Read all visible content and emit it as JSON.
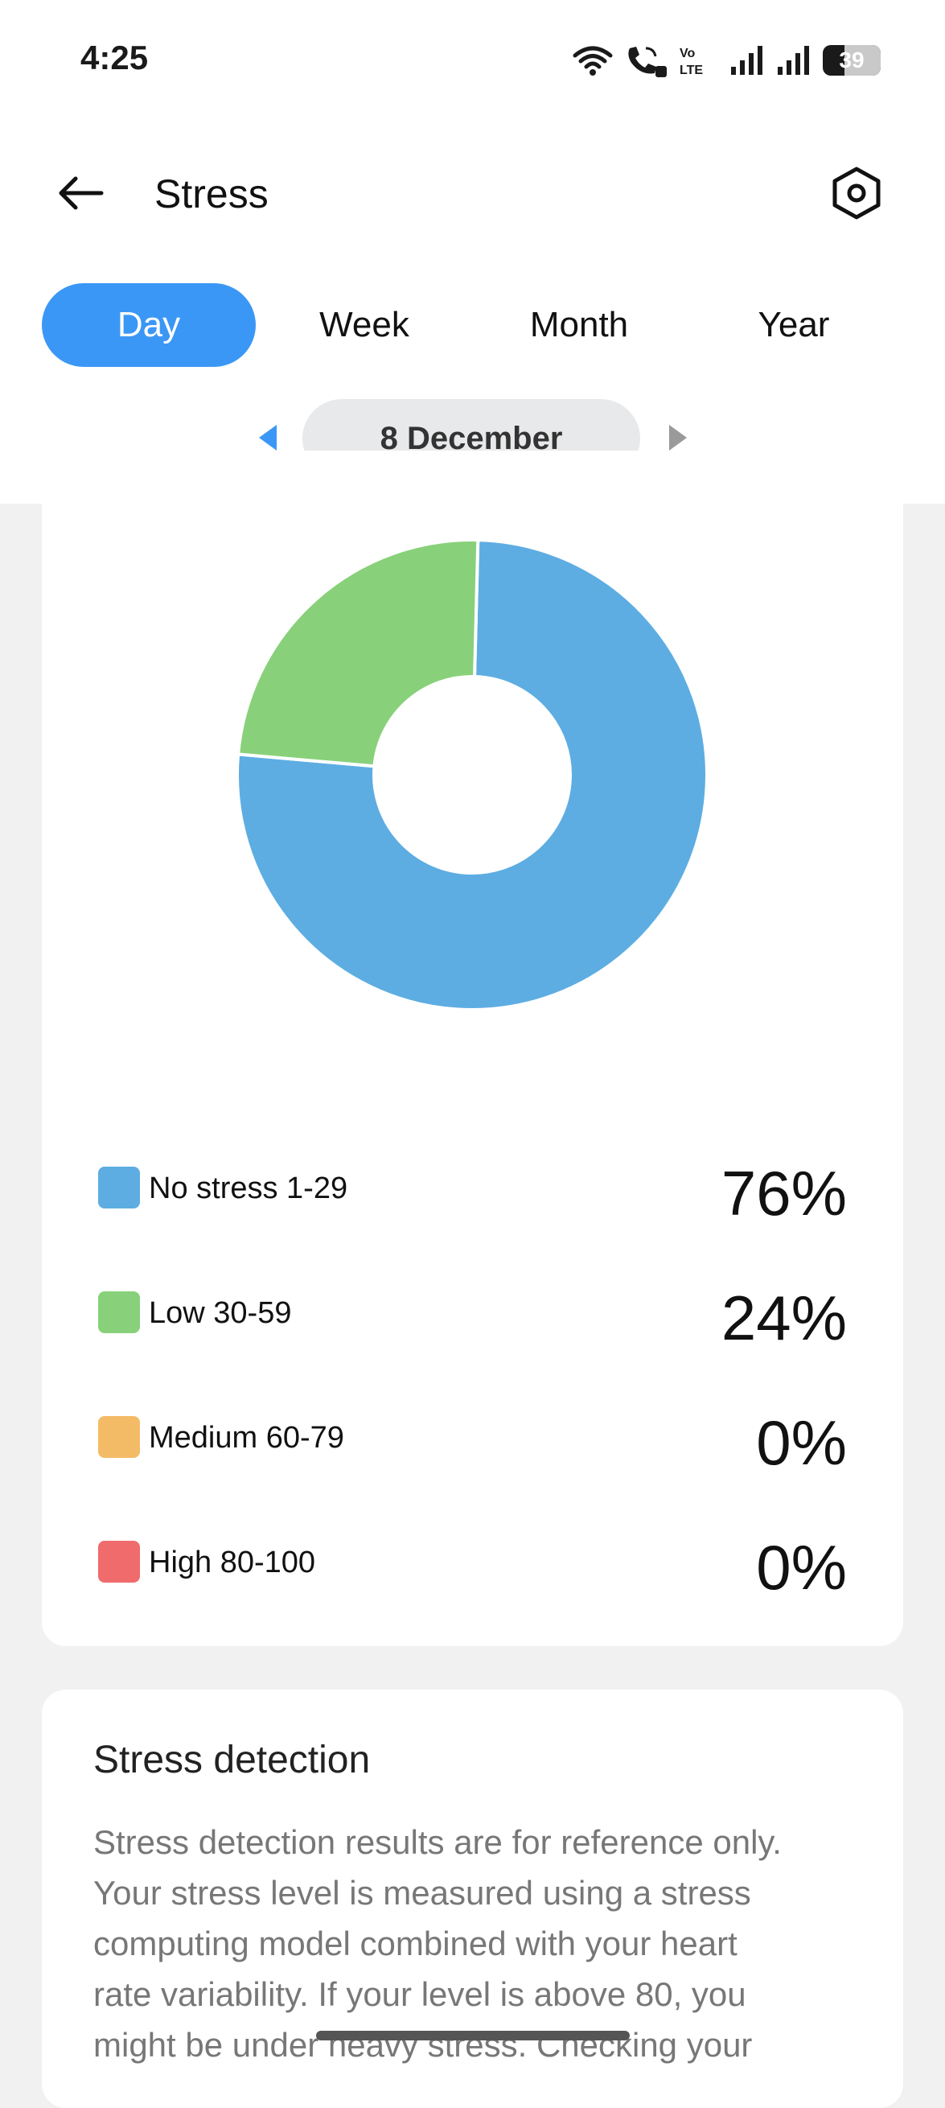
{
  "status_bar": {
    "time": "4:25",
    "battery_percent": "39",
    "icons": [
      "wifi-icon",
      "wifi-calling-icon",
      "volte-icon",
      "signal-icon",
      "signal-icon",
      "battery-icon"
    ]
  },
  "header": {
    "title": "Stress",
    "back_icon": "arrow-left-icon",
    "settings_icon": "settings-hexagon-icon"
  },
  "tabs": [
    {
      "label": "Day",
      "active": true
    },
    {
      "label": "Week",
      "active": false
    },
    {
      "label": "Month",
      "active": false
    },
    {
      "label": "Year",
      "active": false
    }
  ],
  "date_nav": {
    "label": "8 December",
    "prev_icon": "triangle-left-icon",
    "next_icon": "triangle-right-icon"
  },
  "chart_data": {
    "type": "pie",
    "donut": true,
    "categories": [
      "No stress 1-29",
      "Low 30-59",
      "Medium 60-79",
      "High 80-100"
    ],
    "values": [
      76,
      24,
      0,
      0
    ],
    "colors": [
      "#5dade2",
      "#88d17a",
      "#f4bb66",
      "#f06b6b"
    ],
    "title": ""
  },
  "legend": [
    {
      "label": "No stress 1-29",
      "value": "76%",
      "color": "#5dade2"
    },
    {
      "label": "Low 30-59",
      "value": "24%",
      "color": "#88d17a"
    },
    {
      "label": "Medium 60-79",
      "value": "0%",
      "color": "#f4bb66"
    },
    {
      "label": "High 80-100",
      "value": "0%",
      "color": "#f06b6b"
    }
  ],
  "stress_detection": {
    "title": "Stress detection",
    "lines": [
      "Stress detection results are for reference only.",
      "Your stress level is measured using a stress",
      "computing model combined with your heart",
      "rate variability. If your level is above 80, you",
      "might be under heavy stress. Checking your"
    ]
  },
  "colors": {
    "accent": "#3b97f5",
    "background": "#f1f1f1"
  }
}
